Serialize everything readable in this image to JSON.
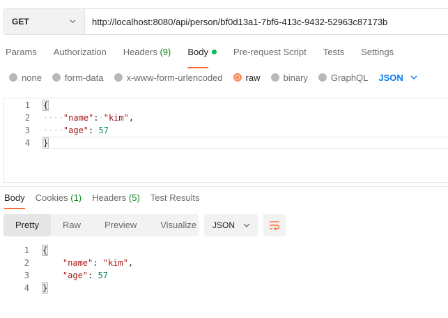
{
  "request": {
    "method": "GET",
    "url": "http://localhost:8080/api/person/bf0d13a1-7bf6-413c-9432-52963c87173b"
  },
  "request_tabs": [
    {
      "label": "Params",
      "count": ""
    },
    {
      "label": "Authorization",
      "count": ""
    },
    {
      "label": "Headers",
      "count": "(9)"
    },
    {
      "label": "Body",
      "count": ""
    },
    {
      "label": "Pre-request Script",
      "count": ""
    },
    {
      "label": "Tests",
      "count": ""
    },
    {
      "label": "Settings",
      "count": ""
    }
  ],
  "active_request_tab": "Body",
  "body_types": [
    "none",
    "form-data",
    "x-www-form-urlencoded",
    "raw",
    "binary",
    "GraphQL"
  ],
  "selected_body_type": "raw",
  "body_language": "JSON",
  "request_body": {
    "line_numbers": [
      "1",
      "2",
      "3",
      "4"
    ],
    "open_brace": "{",
    "close_brace": "}",
    "key1": "\"name\"",
    "value1": "\"kim\"",
    "key2": "\"age\"",
    "value2": "57"
  },
  "response_tabs": [
    {
      "label": "Body",
      "count": ""
    },
    {
      "label": "Cookies",
      "count": "(1)"
    },
    {
      "label": "Headers",
      "count": "(5)"
    },
    {
      "label": "Test Results",
      "count": ""
    }
  ],
  "active_response_tab": "Body",
  "view_modes": [
    "Pretty",
    "Raw",
    "Preview",
    "Visualize"
  ],
  "active_view_mode": "Pretty",
  "response_format": "JSON",
  "response_body": {
    "line_numbers": [
      "1",
      "2",
      "3",
      "4"
    ],
    "open_brace": "{",
    "close_brace": "}",
    "key1": "\"name\"",
    "value1": "\"kim\"",
    "key2": "\"age\"",
    "value2": "57"
  },
  "colors": {
    "accent": "#ff6c37",
    "link_blue": "#097bed",
    "count_green": "#0c8a1f",
    "body_dot": "#0cbb52"
  },
  "icons": {
    "method_dropdown": "chevron-down-icon",
    "language_dropdown": "chevron-down-icon",
    "format_dropdown": "chevron-down-icon",
    "wrap": "wrap-lines-icon"
  }
}
